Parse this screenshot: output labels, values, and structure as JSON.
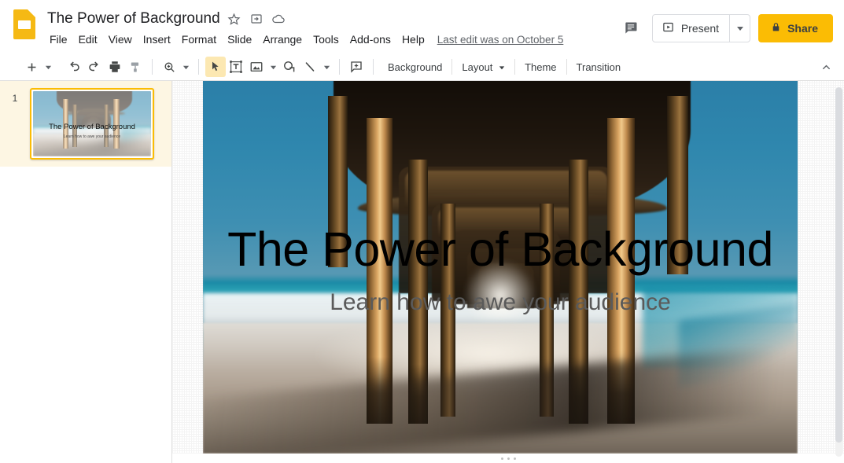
{
  "app": {
    "logo_icon": "google-slides-logo",
    "doc_title": "The Power of Background",
    "star_icon": "star-icon",
    "move_icon": "move-to-folder-icon",
    "cloud_icon": "cloud-saved-icon"
  },
  "menubar": {
    "items": [
      {
        "label": "File"
      },
      {
        "label": "Edit"
      },
      {
        "label": "View"
      },
      {
        "label": "Insert"
      },
      {
        "label": "Format"
      },
      {
        "label": "Slide"
      },
      {
        "label": "Arrange"
      },
      {
        "label": "Tools"
      },
      {
        "label": "Add-ons"
      },
      {
        "label": "Help"
      }
    ],
    "last_edit": "Last edit was on October 5"
  },
  "header_right": {
    "comment_icon": "comment-icon",
    "present_label": "Present",
    "present_icon": "present-play-icon",
    "present_caret_icon": "chevron-down-icon",
    "share_label": "Share",
    "share_lock_icon": "lock-icon",
    "share_color": "#fbbc04"
  },
  "toolbar": {
    "icons": [
      {
        "name": "new-slide-icon",
        "glyph": "plus"
      },
      {
        "name": "undo-icon",
        "glyph": "undo"
      },
      {
        "name": "redo-icon",
        "glyph": "redo"
      },
      {
        "name": "print-icon",
        "glyph": "print"
      },
      {
        "name": "paint-format-icon",
        "glyph": "brush"
      },
      {
        "name": "zoom-icon",
        "glyph": "magnifier"
      },
      {
        "name": "select-tool-icon",
        "glyph": "cursor"
      },
      {
        "name": "text-box-icon",
        "glyph": "textbox"
      },
      {
        "name": "insert-image-icon",
        "glyph": "image"
      },
      {
        "name": "shape-icon",
        "glyph": "shape"
      },
      {
        "name": "line-icon",
        "glyph": "line"
      },
      {
        "name": "add-comment-icon",
        "glyph": "comment-plus"
      }
    ],
    "active_tool": "select-tool-icon",
    "buttons": [
      {
        "label": "Background"
      },
      {
        "label": "Layout",
        "has_caret": true
      },
      {
        "label": "Theme"
      },
      {
        "label": "Transition"
      }
    ],
    "collapse_icon": "chevron-up-icon"
  },
  "filmstrip": {
    "slides": [
      {
        "number": "1",
        "title": "The Power of Background",
        "subtitle": "Learn how to awe your audience",
        "selected": true
      }
    ],
    "selected_bg": "#fdf6e3",
    "selected_border": "#fbbc04"
  },
  "slide": {
    "title": "The Power of Background",
    "subtitle": "Learn how to awe your audience",
    "title_color": "#000000",
    "subtitle_color": "#5a5a5a",
    "background_image": "pier-underside-beach-photo"
  },
  "canvas": {
    "grip_handle": "slide-resize-grip",
    "scrollbar": "vertical-scrollbar"
  }
}
